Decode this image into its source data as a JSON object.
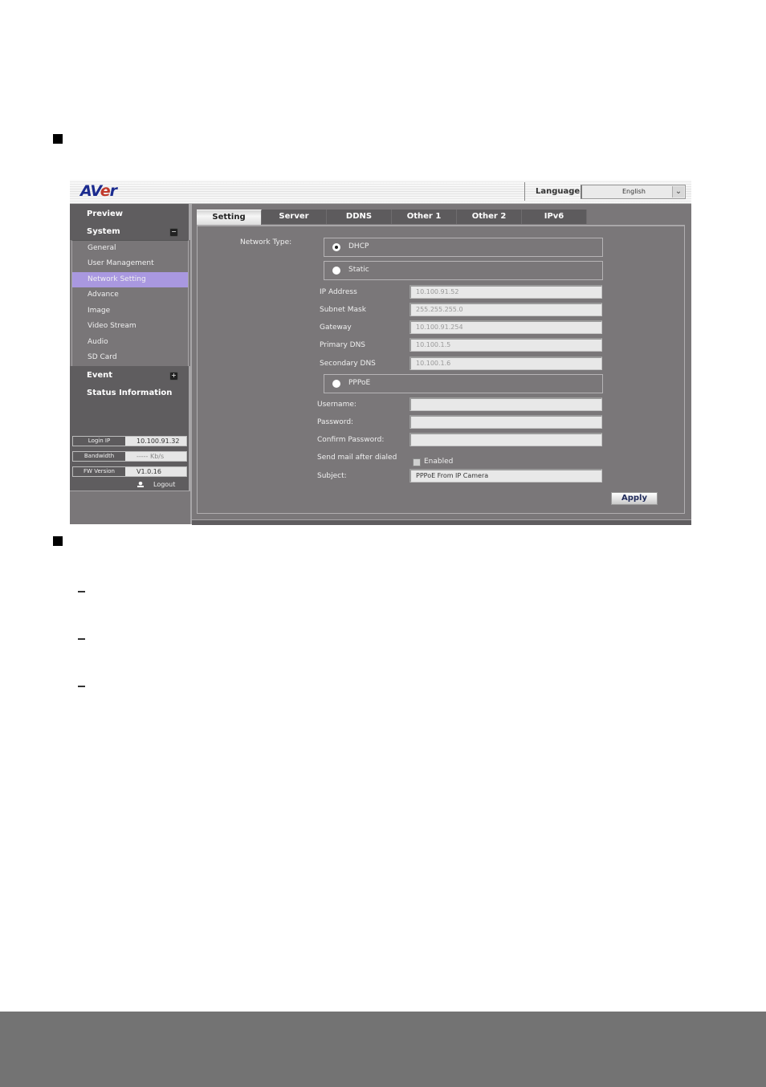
{
  "app": {
    "logo": "AVer",
    "language_label": "Language",
    "language_value": "English",
    "sidebar": {
      "preview": "Preview",
      "system": "System",
      "system_items": [
        "General",
        "User Management",
        "Network Setting",
        "Advance",
        "Image",
        "Video Stream",
        "Audio",
        "SD Card"
      ],
      "active_item": "Network Setting",
      "event": "Event",
      "status_information": "Status Information",
      "info": [
        {
          "key": "Login IP",
          "value": "10.100.91.32"
        },
        {
          "key": "Bandwidth",
          "value": "----- Kb/s"
        },
        {
          "key": "FW Version",
          "value": "V1.0.16"
        }
      ],
      "logout": "Logout"
    },
    "tabs": [
      "Setting",
      "Server",
      "DDNS",
      "Other 1",
      "Other 2",
      "IPv6"
    ],
    "active_tab": "Setting",
    "form": {
      "network_type_label": "Network Type:",
      "dhcp_label": "DHCP",
      "static_label": "Static",
      "pppoe_label": "PPPoE",
      "selected": "DHCP",
      "static_fields": [
        {
          "label": "IP Address",
          "value": "10.100.91.52"
        },
        {
          "label": "Subnet Mask",
          "value": "255.255.255.0"
        },
        {
          "label": "Gateway",
          "value": "10.100.91.254"
        },
        {
          "label": "Primary DNS",
          "value": "10.100.1.5"
        },
        {
          "label": "Secondary DNS",
          "value": "10.100.1.6"
        }
      ],
      "pppoe_fields": [
        {
          "label": "Username:",
          "value": ""
        },
        {
          "label": "Password:",
          "value": ""
        },
        {
          "label": "Confirm Password:",
          "value": ""
        }
      ],
      "send_mail_label": "Send mail after dialed",
      "enabled_label": "Enabled",
      "enabled_checked": false,
      "subject_label": "Subject:",
      "subject_value": "PPPoE From IP Camera",
      "apply_label": "Apply"
    }
  }
}
